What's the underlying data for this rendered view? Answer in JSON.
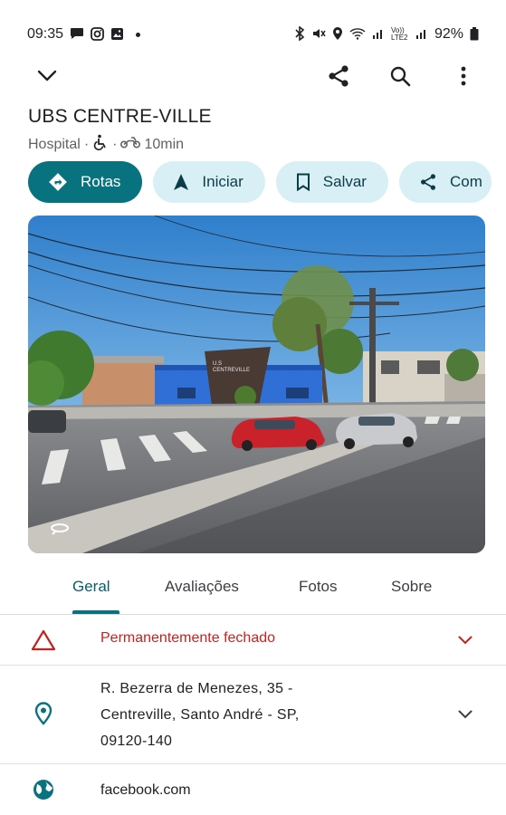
{
  "status_bar": {
    "time": "09:35",
    "battery": "92%",
    "network": "Vo)) LTE2"
  },
  "toolbar": {
    "back_icon": "chevron-down-icon",
    "share_icon": "share-icon",
    "search_icon": "search-icon",
    "more_icon": "more-vert-icon"
  },
  "place": {
    "title": "UBS CENTRE-VILLE",
    "category": "Hospital",
    "separator": "·",
    "travel_time": "10min"
  },
  "actions": [
    {
      "label": "Rotas",
      "icon": "directions-icon",
      "style": "primary"
    },
    {
      "label": "Iniciar",
      "icon": "navigation-arrow-icon",
      "style": "secondary"
    },
    {
      "label": "Salvar",
      "icon": "bookmark-icon",
      "style": "secondary"
    },
    {
      "label": "Com",
      "icon": "share-icon",
      "style": "secondary"
    }
  ],
  "photo": {
    "building_sign_line1": "U.S",
    "building_sign_line2": "CENTREVILLE"
  },
  "tabs": [
    {
      "label": "Geral",
      "active": true
    },
    {
      "label": "Avaliações",
      "active": false
    },
    {
      "label": "Fotos",
      "active": false
    },
    {
      "label": "Sobre",
      "active": false
    }
  ],
  "info": {
    "status": "Permanentemente fechado",
    "address_lines": [
      "R. Bezerra de Menezes, 35 -",
      "Centreville, Santo André - SP,",
      "09120-140"
    ],
    "website": "facebook.com"
  },
  "colors": {
    "accent": "#08737f",
    "chip_bg": "#d8f0f5",
    "closed_red": "#c5221f"
  }
}
